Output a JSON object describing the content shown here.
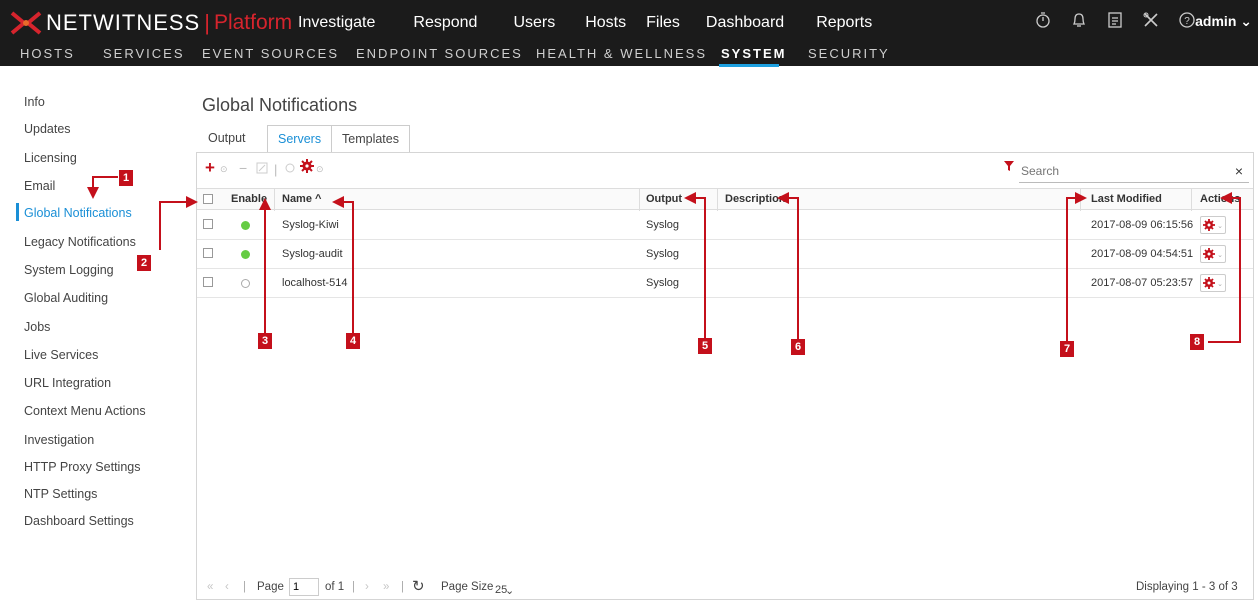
{
  "brand": {
    "name": "NETWITNESS",
    "separator": "|",
    "product": "Platform"
  },
  "main_nav": [
    "Investigate",
    "Respond",
    "Users",
    "Hosts",
    "Files",
    "Dashboard",
    "Reports"
  ],
  "toolbar_icons": [
    "timer-icon",
    "bell-icon",
    "notes-icon",
    "tools-icon",
    "help-icon"
  ],
  "user": {
    "label": "admin ⌄"
  },
  "sub_nav": {
    "items": [
      "HOSTS",
      "SERVICES",
      "EVENT SOURCES",
      "ENDPOINT SOURCES",
      "HEALTH & WELLNESS",
      "SYSTEM",
      "SECURITY"
    ],
    "active": "SYSTEM"
  },
  "sidebar": {
    "items": [
      "Info",
      "Updates",
      "Licensing",
      "Email",
      "Global Notifications",
      "Legacy Notifications",
      "System Logging",
      "Global Auditing",
      "Jobs",
      "Live Services",
      "URL Integration",
      "Context Menu Actions",
      "Investigation",
      "HTTP Proxy Settings",
      "NTP Settings",
      "Dashboard Settings"
    ],
    "active": "Global Notifications"
  },
  "page": {
    "title": "Global Notifications"
  },
  "tabs": {
    "output": "Output",
    "servers": "Servers",
    "templates": "Templates",
    "active": "Servers"
  },
  "search": {
    "placeholder": "Search",
    "clear": "×"
  },
  "table": {
    "headers": {
      "enable": "Enable",
      "name": "Name ^",
      "output": "Output",
      "description": "Description",
      "last_modified": "Last Modified",
      "actions": "Actions"
    },
    "rows": [
      {
        "enabled": true,
        "name": "Syslog-Kiwi",
        "output": "Syslog",
        "description": "",
        "last_modified": "2017-08-09 06:15:56"
      },
      {
        "enabled": true,
        "name": "Syslog-audit",
        "output": "Syslog",
        "description": "",
        "last_modified": "2017-08-09 04:54:51"
      },
      {
        "enabled": false,
        "name": "localhost-514",
        "output": "Syslog",
        "description": "",
        "last_modified": "2017-08-07 05:23:57"
      }
    ]
  },
  "pager": {
    "page_label": "Page",
    "page_value": "1",
    "of_label": "of 1",
    "page_size_label": "Page Size",
    "page_size_value": "25",
    "displaying": "Displaying 1 - 3 of 3"
  },
  "callouts": [
    "1",
    "2",
    "3",
    "4",
    "5",
    "6",
    "7",
    "8"
  ],
  "colors": {
    "callout": "#c4101b",
    "accent": "#1a8fd6",
    "brand_red": "#d6242d",
    "enabled_dot": "#66cc44",
    "topbar": "#1b1b1b"
  }
}
